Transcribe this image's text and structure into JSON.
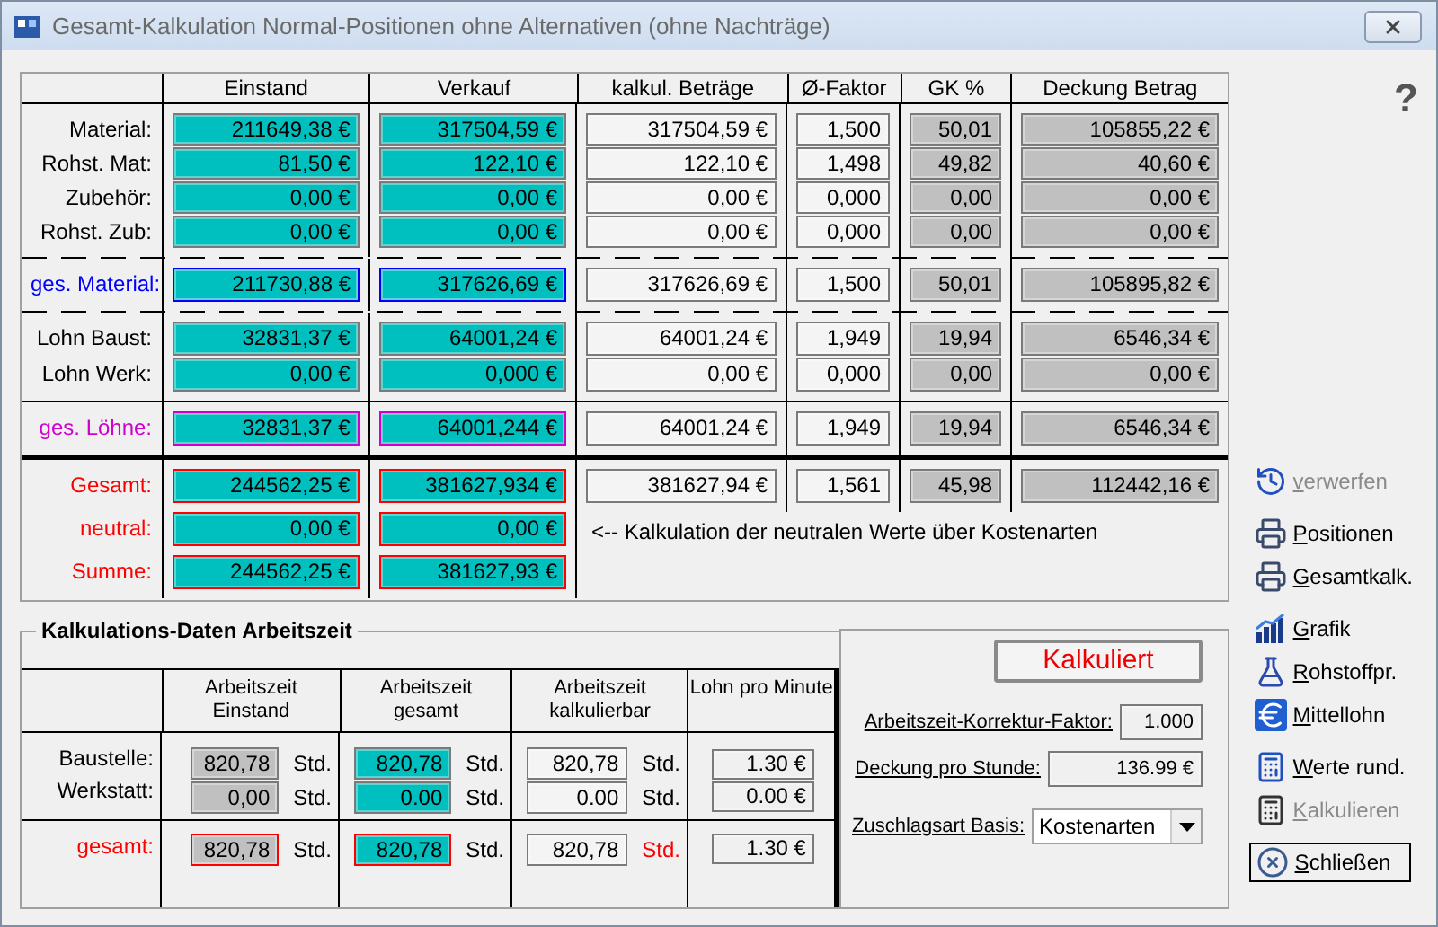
{
  "window": {
    "title": "Gesamt-Kalkulation Normal-Positionen ohne Alternativen (ohne Nachträge)"
  },
  "help": "?",
  "table": {
    "columns": [
      "Einstand",
      "Verkauf",
      "kalkul. Beträge",
      "Ø-Faktor",
      "GK %",
      "Deckung Betrag"
    ],
    "groups": [
      {
        "kind": "material",
        "rows": [
          {
            "label": "Material:",
            "values": [
              "211649,38 €",
              "317504,59 €",
              "317504,59 €",
              "1,500",
              "50,01",
              "105855,22 €"
            ]
          },
          {
            "label": "Rohst. Mat:",
            "values": [
              "81,50 €",
              "122,10 €",
              "122,10 €",
              "1,498",
              "49,82",
              "40,60 €"
            ]
          },
          {
            "label": "Zubehör:",
            "values": [
              "0,00 €",
              "0,00 €",
              "0,00 €",
              "0,000",
              "0,00",
              "0,00 €"
            ]
          },
          {
            "label": "Rohst. Zub:",
            "values": [
              "0,00 €",
              "0,00 €",
              "0,00 €",
              "0,000",
              "0,00",
              "0,00 €"
            ]
          }
        ]
      },
      {
        "kind": "material_total",
        "rows": [
          {
            "label": "ges. Material:",
            "values": [
              "211730,88 €",
              "317626,69 €",
              "317626,69 €",
              "1,500",
              "50,01",
              "105895,82 €"
            ]
          }
        ]
      },
      {
        "kind": "wages",
        "rows": [
          {
            "label": "Lohn Baust:",
            "values": [
              "32831,37 €",
              "64001,24 €",
              "64001,24 €",
              "1,949",
              "19,94",
              "6546,34 €"
            ]
          },
          {
            "label": "Lohn Werk:",
            "values": [
              "0,00 €",
              "0,000 €",
              "0,00 €",
              "0,000",
              "0,00",
              "0,00 €"
            ]
          }
        ]
      },
      {
        "kind": "wage_total",
        "rows": [
          {
            "label": "ges. Löhne:",
            "values": [
              "32831,37 €",
              "64001,244 €",
              "64001,24 €",
              "1,949",
              "19,94",
              "6546,34 €"
            ]
          }
        ]
      },
      {
        "kind": "totals",
        "note": "<-- Kalkulation der neutralen Werte über Kostenarten",
        "rows": [
          {
            "label": "Gesamt:",
            "values": [
              "244562,25 €",
              "381627,934 €",
              "381627,94 €",
              "1,561",
              "45,98",
              "112442,16 €"
            ]
          },
          {
            "label": "neutral:",
            "values": [
              "0,00 €",
              "0,00 €"
            ]
          },
          {
            "label": "Summe:",
            "values": [
              "244562,25 €",
              "381627,93 €"
            ]
          }
        ]
      }
    ]
  },
  "worktime": {
    "title": "Kalkulations-Daten Arbeitszeit",
    "columns": [
      "Arbeitszeit\nEinstand",
      "Arbeitszeit\ngesamt",
      "Arbeitszeit\nkalkulierbar",
      "Lohn pro Minute"
    ],
    "groups": [
      {
        "kind": "item",
        "rows": [
          {
            "label": "Baustelle:",
            "cells": [
              {
                "value": "820,78",
                "unit": "Std.",
                "alert": false,
                "unit_alert": false
              },
              {
                "value": "820,78",
                "unit": "Std.",
                "alert": false,
                "unit_alert": false
              },
              {
                "value": "820,78",
                "unit": "Std.",
                "alert": false,
                "unit_alert": false
              }
            ],
            "wage": "1.30 €"
          },
          {
            "label": "Werkstatt:",
            "cells": [
              {
                "value": "0,00",
                "unit": "Std.",
                "alert": false,
                "unit_alert": false
              },
              {
                "value": "0.00",
                "unit": "Std.",
                "alert": false,
                "unit_alert": false
              },
              {
                "value": "0.00",
                "unit": "Std.",
                "alert": false,
                "unit_alert": false
              }
            ],
            "wage": "0.00 €"
          }
        ]
      },
      {
        "kind": "total",
        "rows": [
          {
            "label": "gesamt:",
            "cells": [
              {
                "value": "820,78",
                "unit": "Std.",
                "alert": true,
                "unit_alert": false
              },
              {
                "value": "820,78",
                "unit": "Std.",
                "alert": true,
                "unit_alert": false
              },
              {
                "value": "820,78",
                "unit": "Std.",
                "alert": false,
                "unit_alert": true
              }
            ],
            "wage": "1.30 €"
          }
        ]
      }
    ]
  },
  "summary": {
    "status": "Kalkuliert",
    "fields": [
      {
        "label": "Arbeitszeit-Korrektur-Faktor:",
        "value": "1.000"
      },
      {
        "label": "Deckung pro Stunde:",
        "value": "136.99 €"
      }
    ],
    "basis": {
      "label": "Zuschlagsart Basis:",
      "value": "Kostenarten"
    }
  },
  "actions": [
    [
      {
        "label": "verwerfen",
        "disabled": true
      }
    ],
    [
      {
        "label": "Positionen",
        "disabled": false
      },
      {
        "label": "Gesamtkalk.",
        "disabled": false
      }
    ],
    [
      {
        "label": "Grafik",
        "disabled": false
      },
      {
        "label": "Rohstoffpr.",
        "disabled": false
      },
      {
        "label": "Mittellohn",
        "disabled": false
      }
    ],
    [
      {
        "label": "Werte rund.",
        "disabled": false
      },
      {
        "label": "Kalkulieren",
        "disabled": true
      }
    ],
    [
      {
        "label": "Schließen",
        "disabled": false
      }
    ]
  ]
}
